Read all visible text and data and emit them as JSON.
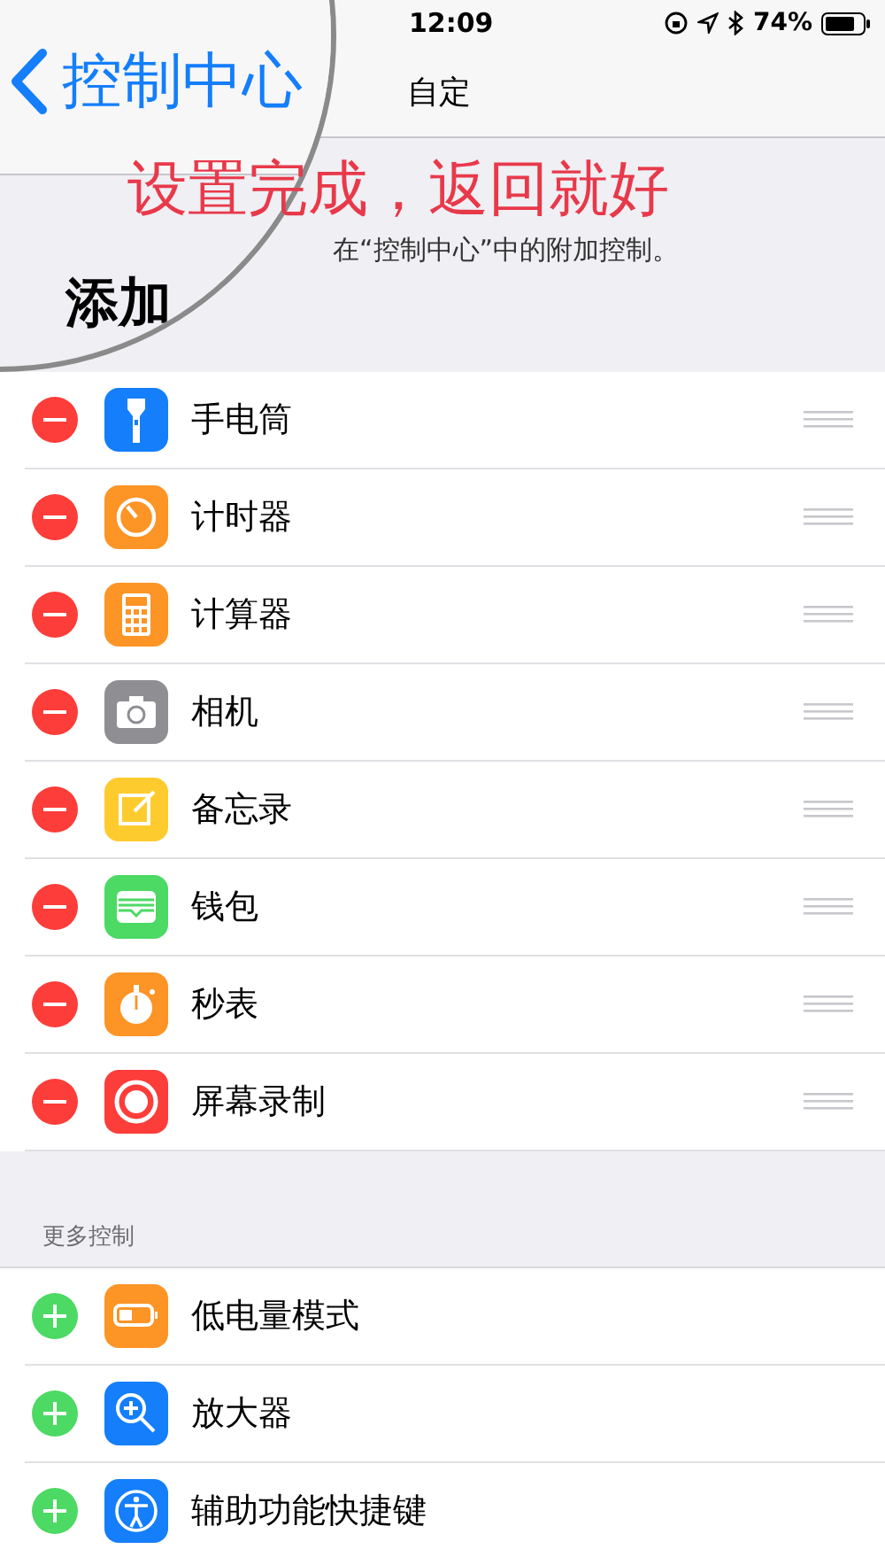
{
  "status_bar": {
    "time": "12:09",
    "battery": "74%"
  },
  "nav": {
    "title": "自定"
  },
  "annotation": "设置完成，返回就好",
  "description": "在“控制中心”中的附加控制。",
  "magnifier": {
    "back_label": "控制中心",
    "heading": "添加"
  },
  "included": [
    {
      "kind": "remove",
      "color": "#147efb",
      "label": "手电筒"
    },
    {
      "kind": "remove",
      "color": "#fd9426",
      "label": "计时器"
    },
    {
      "kind": "remove",
      "color": "#fd9426",
      "label": "计算器"
    },
    {
      "kind": "remove",
      "color": "#8e8e93",
      "label": "相机"
    },
    {
      "kind": "remove",
      "color": "#fecb2e",
      "label": "备忘录"
    },
    {
      "kind": "remove",
      "color": "#4cd964",
      "label": "钱包"
    },
    {
      "kind": "remove",
      "color": "#fd9426",
      "label": "秒表"
    },
    {
      "kind": "remove",
      "color": "#fc3d39",
      "label": "屏幕录制"
    }
  ],
  "more_header": "更多控制",
  "more": [
    {
      "kind": "add",
      "color": "#fd9426",
      "label": "低电量模式"
    },
    {
      "kind": "add",
      "color": "#147efb",
      "label": "放大器"
    },
    {
      "kind": "add",
      "color": "#147efb",
      "label": "辅助功能快捷键"
    }
  ]
}
